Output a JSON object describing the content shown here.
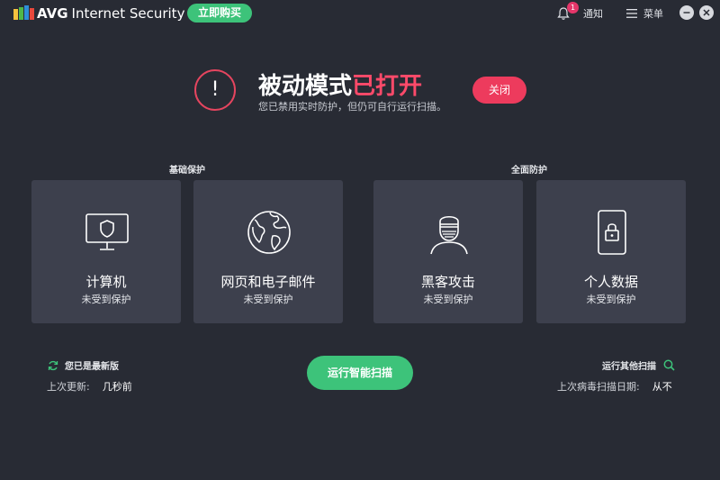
{
  "header": {
    "brand": "AVG",
    "product": "Internet Security",
    "buy_label": "立即购买",
    "notifications_label": "通知",
    "notifications_count": "1",
    "menu_label": "菜单"
  },
  "banner": {
    "title_main": "被动模式",
    "title_highlight": "已打开",
    "subtitle": "您已禁用实时防护，但仍可自行运行扫描。",
    "close_label": "关闭",
    "alert_glyph": "!"
  },
  "sections": {
    "basic": "基础保护",
    "full": "全面防护"
  },
  "cards": [
    {
      "name": "计算机",
      "status": "未受到保护",
      "icon": "computer-shield-icon"
    },
    {
      "name": "网页和电子邮件",
      "status": "未受到保护",
      "icon": "globe-icon"
    },
    {
      "name": "黑客攻击",
      "status": "未受到保护",
      "icon": "hacker-icon"
    },
    {
      "name": "个人数据",
      "status": "未受到保护",
      "icon": "phone-lock-icon"
    }
  ],
  "footer": {
    "uptodate_label": "您已是最新版",
    "last_update_label": "上次更新:",
    "last_update_value": "几秒前",
    "scan_button": "运行智能扫描",
    "other_scan_label": "运行其他扫描",
    "last_scan_label": "上次病毒扫描日期:",
    "last_scan_value": "从不"
  },
  "colors": {
    "background": "#282b34",
    "card": "#3d404d",
    "accent_green": "#3dc37a",
    "accent_red": "#ed3b5d",
    "alert_text": "#ff4a6a"
  }
}
